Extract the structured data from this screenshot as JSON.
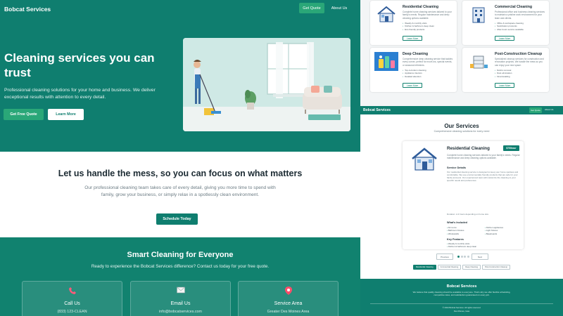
{
  "site": {
    "brand": "Bobcat Services"
  },
  "nav": {
    "quote_label": "Get Quote",
    "about_label": "About Us"
  },
  "hero": {
    "title": "Cleaning services you can trust",
    "subtitle": "Professional cleaning solutions for your home and business. We deliver exceptional results with attention to every detail.",
    "primary_cta": "Get Free Quote",
    "secondary_cta": "Learn More"
  },
  "mission": {
    "title": "Let us handle the mess, so you can focus on what matters",
    "body": "Our professional cleaning team takes care of every detail, giving you more time to spend with family, grow your business, or simply relax in a spotlessly clean environment.",
    "cta": "Schedule Today"
  },
  "contact": {
    "title": "Smart Cleaning for Everyone",
    "subtitle": "Ready to experience the Bobcat Services difference? Contact us today for your free quote.",
    "cards": [
      {
        "title": "Call Us",
        "value": "(833) 123-CLEAN",
        "icon": "phone-icon"
      },
      {
        "title": "Email Us",
        "value": "info@bobcatservices.com",
        "icon": "email-icon"
      },
      {
        "title": "Service Area",
        "value": "Greater Des Moines Area",
        "icon": "location-pin-icon"
      }
    ]
  },
  "services_grid": [
    {
      "title": "Residential Cleaning",
      "desc": "Complete home cleaning services tailored to your family's needs. Regular maintenance and deep cleaning options available.",
      "items": [
        "Weekly & monthly visits",
        "Kitchen & bathroom deep clean",
        "Eco-friendly products"
      ],
      "button": "Learn More"
    },
    {
      "title": "Commercial Cleaning",
      "desc": "Professional office and business cleaning services to maintain a pristine work environment for your team and clients.",
      "items": [
        "Office & workspace cleaning",
        "Sanitization protocols",
        "After-hours service available"
      ],
      "button": "Learn More"
    },
    {
      "title": "Deep Cleaning",
      "desc": "Comprehensive deep cleaning service that tackles every corner, perfect for move-ins, special events, or seasonal refreshes.",
      "items": [
        "Top-to-bottom cleaning",
        "Appliance interiors",
        "Detailed attention"
      ],
      "button": "Learn More"
    },
    {
      "title": "Post-Construction Cleanup",
      "desc": "Specialized cleanup services for construction and renovation projects. We handle the mess so you can enjoy your new space.",
      "items": [
        "Debris removal",
        "Dust elimination",
        "Final detailing"
      ],
      "button": "Learn More"
    }
  ],
  "services_page": {
    "nav_brand": "Bobcat Services",
    "nav_quote": "Get Quote",
    "nav_about": "About Us",
    "title": "Our Services",
    "subtitle": "Comprehensive cleaning solutions for every need",
    "detail": {
      "title": "Residential Cleaning",
      "price": "$75/hour",
      "desc": "Complete home cleaning services tailored to your family's needs. Regular maintenance and deep cleaning options available.",
      "details_heading": "Service Details",
      "details_body": "Our residential cleaning service is designed to keep your home spotless and comfortable. We use environmentally friendly products that are safe for your family and pets. Our experienced team will customize the cleaning to your specific needs and preferences.",
      "duration": "Duration: 2-4 hours depending on home size",
      "included_heading": "What's Included",
      "included": [
        "All rooms",
        "Kitchen appliances",
        "Bathroom fixtures",
        "Light fixtures",
        "Windowsills",
        "Baseboards"
      ],
      "features_heading": "Key Features",
      "features": [
        "Weekly & monthly visits",
        "Kitchen & bathroom deep clean",
        "Eco-friendly products",
        "Flexible scheduling",
        "Trained & insured staff",
        "Satisfaction guaranteed"
      ]
    },
    "prev": "Previous",
    "next": "Next",
    "tabs": [
      "Residential Cleaning",
      "Commercial Cleaning",
      "Deep Cleaning",
      "Post-Construction Cleanup"
    ],
    "active_tab": 0,
    "dots_count": 4,
    "active_dot": 0,
    "footer_brand": "Bobcat Services",
    "footer_desc": "We believe that quality cleaning should be available to everyone. That's why we offer flexible scheduling, competitive rates, and satisfaction guaranteed on every job.",
    "footer_copy": "© 2024 Bobcat Services. All rights reserved.",
    "footer_loc": "Des Moines, Iowa"
  },
  "colors": {
    "brand_teal": "#0f7e6f",
    "accent_green": "#2aa778"
  }
}
